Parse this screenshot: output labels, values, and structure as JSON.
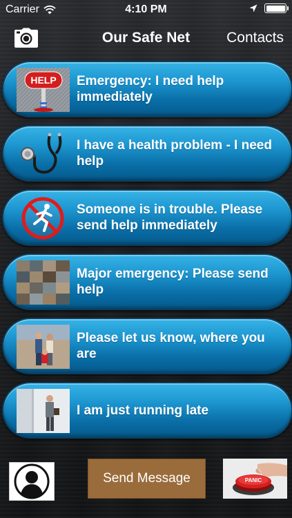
{
  "status_bar": {
    "carrier": "Carrier",
    "time": "4:10 PM",
    "icons": [
      "wifi-icon",
      "location-arrow-icon",
      "battery-icon"
    ],
    "battery_level": 1.0
  },
  "nav": {
    "title": "Our Safe Net",
    "right_button": "Contacts",
    "left_icon": "camera-icon"
  },
  "messages": [
    {
      "label": "Emergency: I need help immediately",
      "icon": "help-sign-icon"
    },
    {
      "label": "I have a health problem - I need help",
      "icon": "stethoscope-icon"
    },
    {
      "label": "Someone is in trouble. Please send help immediately",
      "icon": "running-person-prohibited-icon"
    },
    {
      "label": "Major emergency: Please send help",
      "icon": "disaster-photo-collage"
    },
    {
      "label": "Please let us know, where you are",
      "icon": "people-photo"
    },
    {
      "label": "I am just running late",
      "icon": "man-running-photo"
    }
  ],
  "bottom_bar": {
    "avatar_icon": "contact-avatar-icon",
    "send_button": "Send Message",
    "panic_icon": "panic-button-icon",
    "panic_text": "PANIC"
  },
  "colors": {
    "button_blue": "#1d96d0",
    "send_brown": "#9a6c3b",
    "background": "#1b1c1e"
  }
}
